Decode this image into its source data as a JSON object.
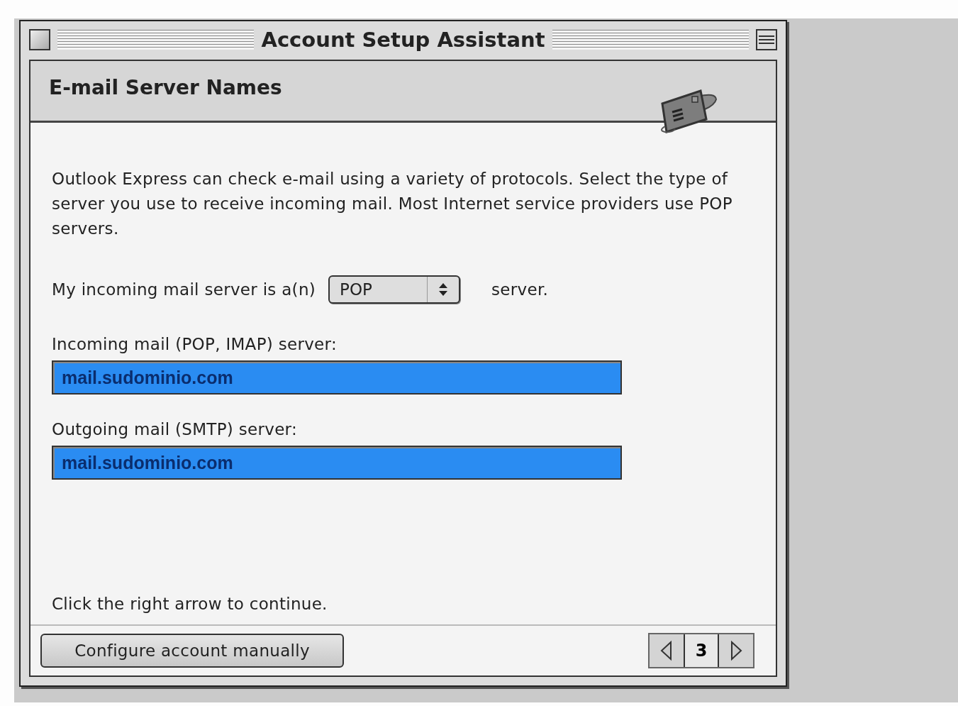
{
  "window": {
    "title": "Account Setup Assistant"
  },
  "header": {
    "title": "E-mail Server Names"
  },
  "intro": "Outlook Express can check e-mail using a variety of protocols. Select the type of server you use to receive incoming mail. Most Internet service providers use POP servers.",
  "server_type": {
    "label": "My incoming mail server is a(n)",
    "value": "POP",
    "suffix": "server."
  },
  "fields": [
    {
      "label": "Incoming mail (POP, IMAP) server:",
      "value": "mail.sudominio.com",
      "selected": true
    },
    {
      "label": "Outgoing mail (SMTP) server:",
      "value": "mail.sudominio.com",
      "selected": true
    }
  ],
  "hint": "Click the right arrow to continue.",
  "footer": {
    "button": "Configure account manually",
    "page": "3"
  }
}
